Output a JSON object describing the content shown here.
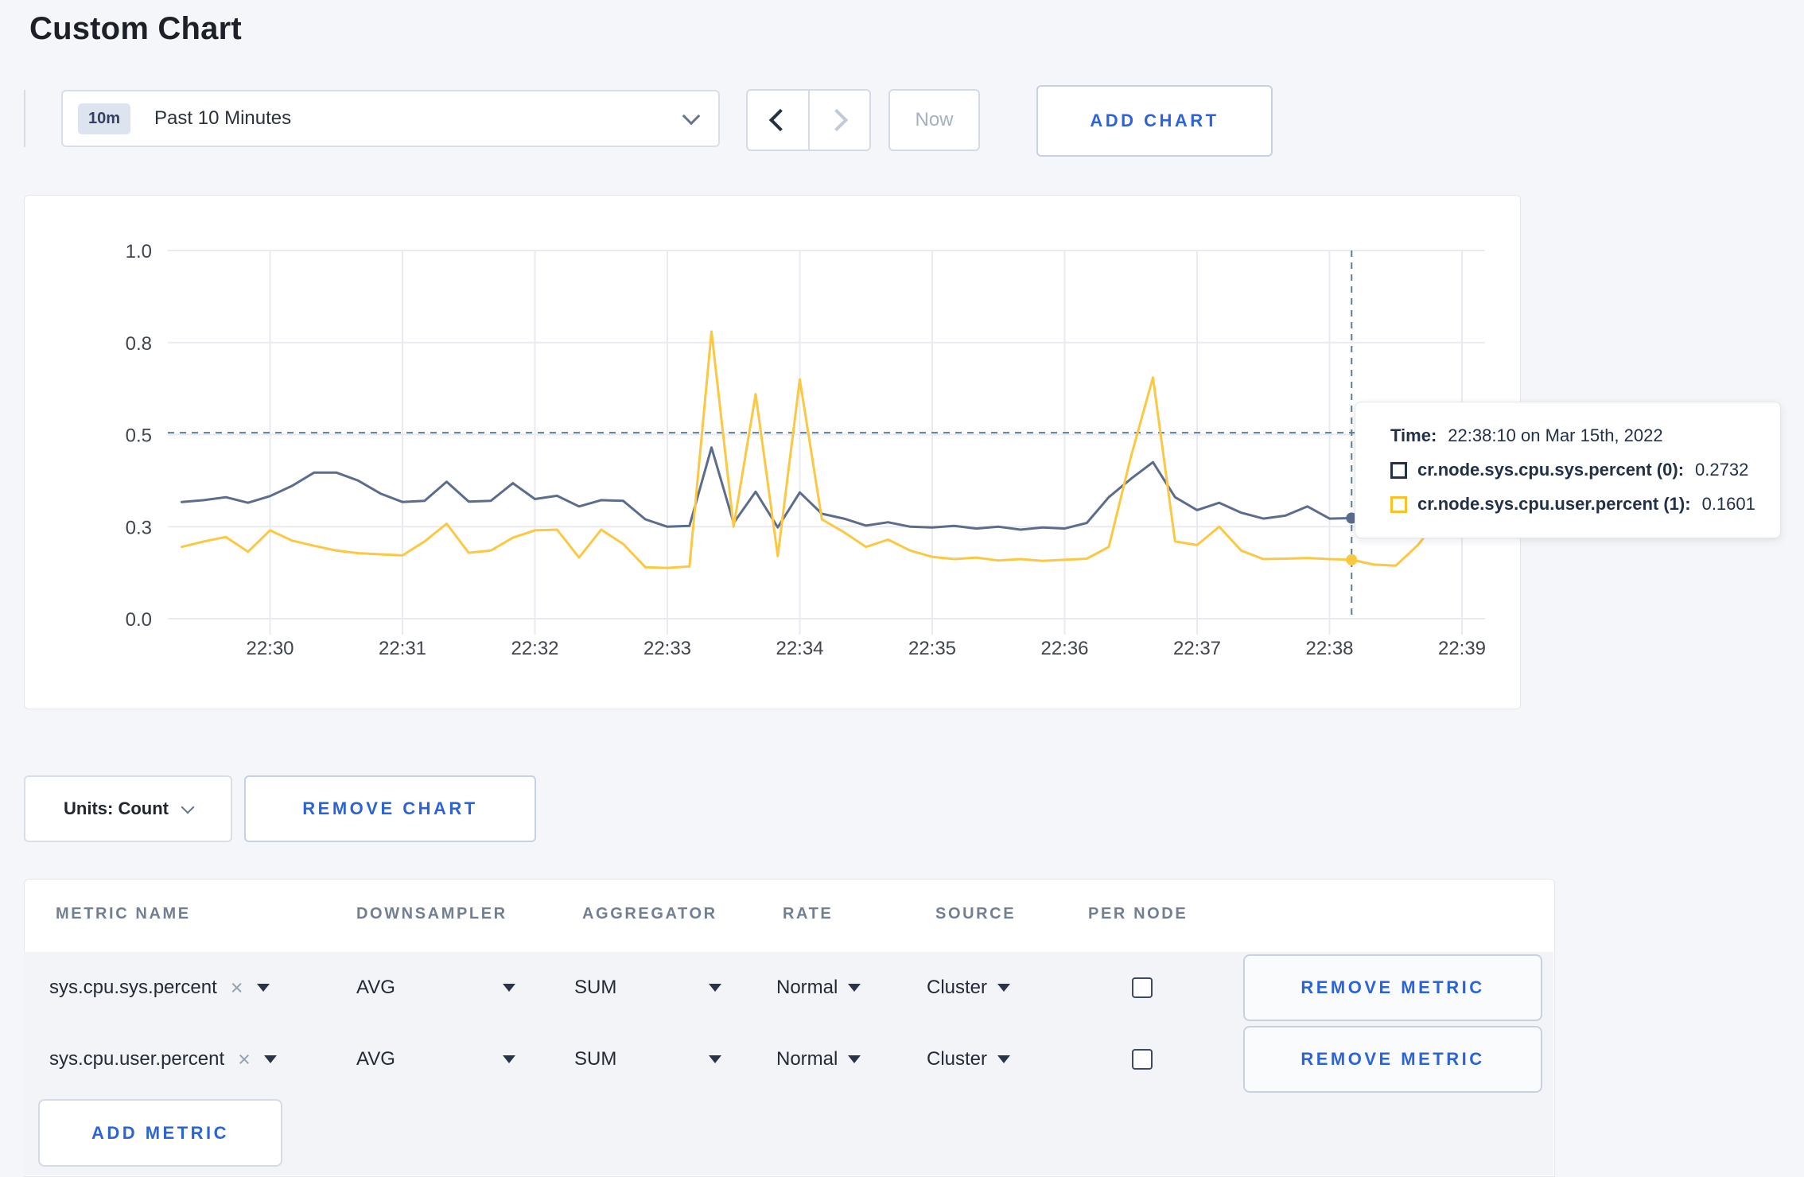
{
  "page": {
    "title": "Custom Chart"
  },
  "colors": {
    "accent_blue": "#2c63d9",
    "page_background": "#f5f6f9",
    "series_sys": "#5b6c8c",
    "series_user": "#fdc841",
    "crosshair": "#5b7f96",
    "gridline": "#e9ebf0"
  },
  "toolbar": {
    "time_range_badge": "10m",
    "time_range_label": "Past 10 Minutes",
    "now_label": "Now",
    "add_chart_label": "ADD CHART"
  },
  "tooltip": {
    "time_label": "Time:",
    "time_value": "22:38:10 on Mar 15th, 2022",
    "rows": [
      {
        "label": "cr.node.sys.cpu.sys.percent (0):",
        "value": "0.2732",
        "color": "#25304a"
      },
      {
        "label": "cr.node.sys.cpu.user.percent (1):",
        "value": "0.1601",
        "color": "#fdc128"
      }
    ]
  },
  "chart_footer": {
    "units_label": "Units: Count",
    "remove_chart_label": "REMOVE CHART"
  },
  "metrics_table": {
    "headers": [
      "METRIC NAME",
      "DOWNSAMPLER",
      "AGGREGATOR",
      "RATE",
      "SOURCE",
      "PER NODE"
    ],
    "remove_metric_label": "REMOVE METRIC",
    "add_metric_label": "ADD METRIC",
    "rows": [
      {
        "metric_name": "sys.cpu.sys.percent",
        "downsampler": "AVG",
        "aggregator": "SUM",
        "rate": "Normal",
        "source": "Cluster",
        "per_node_checked": false
      },
      {
        "metric_name": "sys.cpu.user.percent",
        "downsampler": "AVG",
        "aggregator": "SUM",
        "rate": "Normal",
        "source": "Cluster",
        "per_node_checked": false
      }
    ]
  },
  "chart_data": {
    "type": "line",
    "title": "",
    "xlabel": "",
    "ylabel": "",
    "ylim": [
      0,
      1
    ],
    "grid": true,
    "legend_position": "none",
    "y_tick_labels": [
      "0.0",
      "0.3",
      "0.5",
      "0.8",
      "1.0"
    ],
    "y_tick_values": [
      0,
      0.25,
      0.5,
      0.75,
      1.0
    ],
    "x_tick_labels": [
      "22:30",
      "22:31",
      "22:32",
      "22:33",
      "22:34",
      "22:35",
      "22:36",
      "22:37",
      "22:38",
      "22:39"
    ],
    "x": [
      "22:29:20",
      "22:29:30",
      "22:29:40",
      "22:29:50",
      "22:30:00",
      "22:30:10",
      "22:30:20",
      "22:30:30",
      "22:30:40",
      "22:30:50",
      "22:31:00",
      "22:31:10",
      "22:31:20",
      "22:31:30",
      "22:31:40",
      "22:31:50",
      "22:32:00",
      "22:32:10",
      "22:32:20",
      "22:32:30",
      "22:32:40",
      "22:32:50",
      "22:33:00",
      "22:33:10",
      "22:33:20",
      "22:33:30",
      "22:33:40",
      "22:33:50",
      "22:34:00",
      "22:34:10",
      "22:34:20",
      "22:34:30",
      "22:34:40",
      "22:34:50",
      "22:35:00",
      "22:35:10",
      "22:35:20",
      "22:35:30",
      "22:35:40",
      "22:35:50",
      "22:36:00",
      "22:36:10",
      "22:36:20",
      "22:36:30",
      "22:36:40",
      "22:36:50",
      "22:37:00",
      "22:37:10",
      "22:37:20",
      "22:37:30",
      "22:37:40",
      "22:37:50",
      "22:38:00",
      "22:38:10",
      "22:38:20",
      "22:38:30",
      "22:38:40",
      "22:38:50",
      "22:39:00",
      "22:39:10"
    ],
    "series": [
      {
        "name": "cr.node.sys.cpu.sys.percent",
        "color": "#5b6c8c",
        "values": [
          0.317,
          0.322,
          0.33,
          0.315,
          0.333,
          0.361,
          0.397,
          0.397,
          0.375,
          0.34,
          0.317,
          0.32,
          0.372,
          0.318,
          0.32,
          0.368,
          0.325,
          0.334,
          0.305,
          0.322,
          0.32,
          0.27,
          0.25,
          0.252,
          0.465,
          0.26,
          0.345,
          0.248,
          0.343,
          0.285,
          0.272,
          0.253,
          0.262,
          0.25,
          0.248,
          0.252,
          0.245,
          0.25,
          0.242,
          0.248,
          0.245,
          0.26,
          0.33,
          0.38,
          0.425,
          0.33,
          0.295,
          0.315,
          0.288,
          0.272,
          0.28,
          0.305,
          0.272,
          0.2732,
          0.285,
          0.272,
          0.28,
          0.295,
          0.278,
          0.285
        ]
      },
      {
        "name": "cr.node.sys.cpu.user.percent",
        "color": "#fdc841",
        "values": [
          0.195,
          0.21,
          0.222,
          0.182,
          0.24,
          0.212,
          0.198,
          0.185,
          0.178,
          0.175,
          0.172,
          0.21,
          0.258,
          0.179,
          0.185,
          0.22,
          0.24,
          0.242,
          0.166,
          0.242,
          0.203,
          0.14,
          0.138,
          0.142,
          0.78,
          0.25,
          0.61,
          0.17,
          0.65,
          0.27,
          0.235,
          0.195,
          0.215,
          0.185,
          0.168,
          0.162,
          0.166,
          0.158,
          0.162,
          0.157,
          0.16,
          0.163,
          0.195,
          0.44,
          0.655,
          0.21,
          0.2,
          0.25,
          0.185,
          0.162,
          0.163,
          0.165,
          0.162,
          0.1601,
          0.147,
          0.144,
          0.2,
          0.275,
          0.222,
          0.252
        ]
      }
    ],
    "crosshair": {
      "time": "22:38:10",
      "index": 53,
      "y_value": 0.505
    }
  }
}
